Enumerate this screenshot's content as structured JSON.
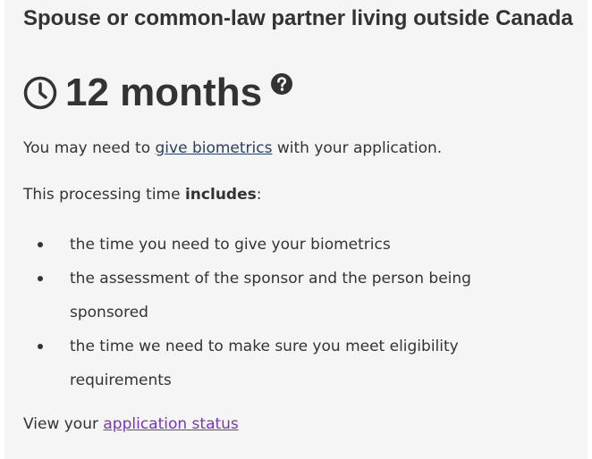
{
  "heading": "Spouse or common-law partner living outside Canada",
  "processing_time": {
    "value": "12 months",
    "icon": "clock-icon",
    "help_icon": "question-circle-icon"
  },
  "biometrics_note": {
    "before": "You may need to ",
    "link": "give biometrics",
    "after": " with your application."
  },
  "includes_note": {
    "before": "This processing time ",
    "bold": "includes",
    "after": ":"
  },
  "includes_items": [
    "the time you need to give your biometrics",
    "the assessment of the sponsor and the person being sponsored",
    "the time we need to make sure you meet eligibility requirements"
  ],
  "status": {
    "before": "View your ",
    "link": "application status"
  },
  "colors": {
    "panel_bg": "#f5f5f5",
    "text": "#333333",
    "link": "#284162",
    "visited_link": "#7834bc"
  }
}
